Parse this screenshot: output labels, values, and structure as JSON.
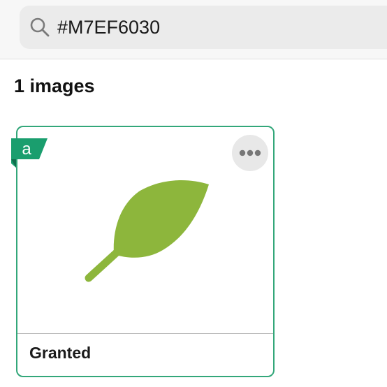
{
  "search": {
    "value": "#M7EF6030",
    "icon": "search-icon"
  },
  "results": {
    "count_label": "1 images"
  },
  "card": {
    "badge_icon": "a-badge-icon",
    "badge_text": "a",
    "menu_icon": "more-dots-icon",
    "image_icon": "leaf-icon",
    "status": "Granted",
    "border_color": "#33a77a",
    "badge_color": "#1a9e6e",
    "leaf_color": "#8db63c"
  }
}
